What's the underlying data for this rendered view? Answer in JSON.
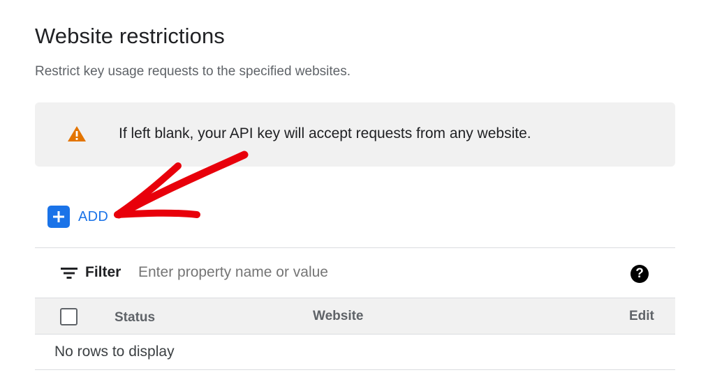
{
  "section": {
    "title": "Website restrictions",
    "description": "Restrict key usage requests to the specified websites."
  },
  "notice": {
    "icon": "warning-icon",
    "text": "If left blank, your API key will accept requests from any website.",
    "icon_color": "#e37400"
  },
  "add_button": {
    "label": "ADD",
    "icon": "plus-icon",
    "color": "#1a73e8"
  },
  "annotation": {
    "icon": "red-arrow",
    "color": "#e8000b"
  },
  "filter": {
    "label": "Filter",
    "placeholder": "Enter property name or value",
    "icon": "filter-icon",
    "help_icon": "help-icon"
  },
  "table": {
    "columns": [
      "Status",
      "Website",
      "Edit"
    ],
    "empty_text": "No rows to display"
  }
}
